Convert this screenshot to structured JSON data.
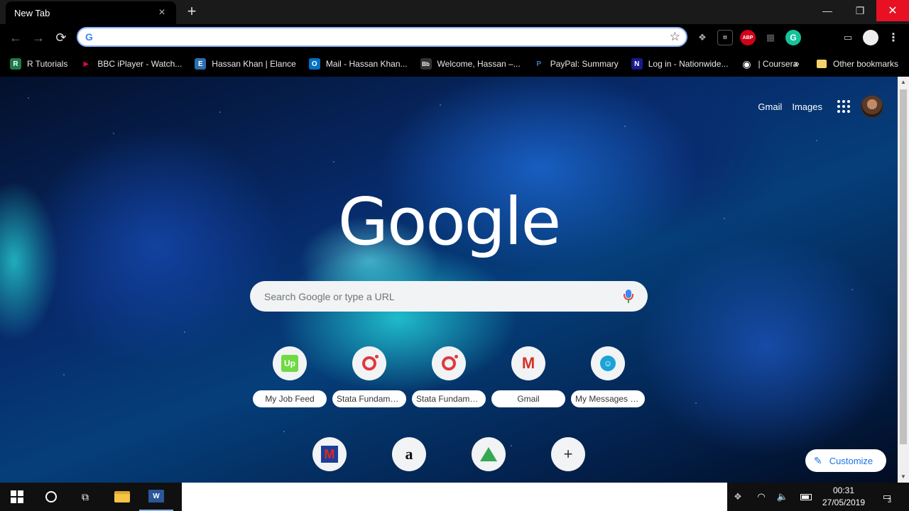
{
  "tab": {
    "title": "New Tab",
    "close_icon": "×",
    "new_tab_icon": "+"
  },
  "window": {
    "minimize": "—",
    "maximize": "❐",
    "close": "✕"
  },
  "toolbar": {
    "back": "←",
    "forward": "→",
    "reload": "⟳",
    "omnibox_value": "",
    "omnibox_icon": "G",
    "star": "☆",
    "extensions": {
      "dropbox": "❖",
      "pdf": "⌗",
      "abp": "ABP",
      "grid": "▦",
      "grammarly": "G",
      "cast": "▭",
      "menu": "⋮"
    }
  },
  "bookmarks": {
    "items": [
      {
        "label": "R Tutorials",
        "icon": "R",
        "color": "#1e7a4a"
      },
      {
        "label": "BBC iPlayer - Watch...",
        "icon": "▶",
        "color": "#e0005a"
      },
      {
        "label": "Hassan Khan | Elance",
        "icon": "E",
        "color": "#2a6fb0"
      },
      {
        "label": "Mail - Hassan Khan...",
        "icon": "O",
        "color": "#0072c6"
      },
      {
        "label": "Welcome, Hassan –...",
        "icon": "Bb",
        "color": "#333333"
      },
      {
        "label": "PayPal: Summary",
        "icon": "P",
        "color": "#003087"
      },
      {
        "label": "Log in - Nationwide...",
        "icon": "N",
        "color": "#1a1a8c"
      },
      {
        "label": "| Coursera",
        "icon": "◉",
        "color": "#444444"
      }
    ],
    "overflow": "»",
    "other": "Other bookmarks"
  },
  "ntp": {
    "links": {
      "gmail": "Gmail",
      "images": "Images"
    },
    "logo": "Google",
    "search_placeholder": "Search Google or type a URL",
    "tiles": [
      {
        "label": "My Job Feed",
        "icon": "upwork-icon",
        "glyph": "Up"
      },
      {
        "label": "Stata Fundame...",
        "icon": "stata-icon",
        "glyph": ""
      },
      {
        "label": "Stata Fundame...",
        "icon": "stata-icon",
        "glyph": ""
      },
      {
        "label": "Gmail",
        "icon": "gmail-icon",
        "glyph": "M"
      },
      {
        "label": "My Messages o...",
        "icon": "messages-icon",
        "glyph": "☺"
      },
      {
        "label": "",
        "icon": "metro-icon",
        "glyph": "M"
      },
      {
        "label": "",
        "icon": "amazon-icon",
        "glyph": "a"
      },
      {
        "label": "",
        "icon": "drive-icon",
        "glyph": ""
      },
      {
        "label": "",
        "icon": "add-shortcut-icon",
        "glyph": "+"
      }
    ],
    "customize": "Customize",
    "customize_icon": "✎"
  },
  "taskbar": {
    "time": "00:31",
    "date": "27/05/2019",
    "notifications": "3",
    "word_icon": "W",
    "taskview_icon": "⧉",
    "volume_icon": "🔈",
    "wifi_icon": "◠",
    "dropbox_icon": "❖",
    "notif_icon": "▭"
  },
  "colors": {
    "accent": "#1a73e8",
    "close_red": "#e81123"
  }
}
